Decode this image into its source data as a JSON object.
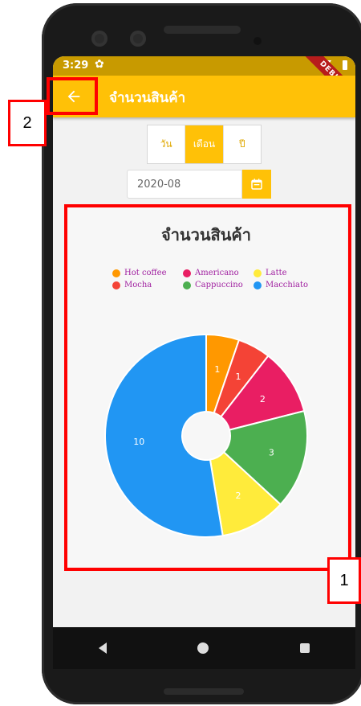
{
  "status_bar": {
    "time": "3:29",
    "debug_banner": "DEBUG"
  },
  "app_bar": {
    "title": "จำนวนสินค้า",
    "back_icon": "arrow-left-icon"
  },
  "period_tabs": [
    {
      "label": "วัน",
      "active": false
    },
    {
      "label": "เดือน",
      "active": true
    },
    {
      "label": "ปี",
      "active": false
    }
  ],
  "date_field": {
    "value": "2020-08",
    "button_icon": "calendar-icon"
  },
  "chart_data": {
    "type": "pie",
    "title": "จำนวนสินค้า",
    "donut": true,
    "legend_position": "top",
    "series": [
      {
        "name": "Hot coffee",
        "value": 1,
        "color": "#ff9800"
      },
      {
        "name": "Mocha",
        "value": 1,
        "color": "#f44336"
      },
      {
        "name": "Americano",
        "value": 2,
        "color": "#e91e63"
      },
      {
        "name": "Cappuccino",
        "value": 3,
        "color": "#4caf50"
      },
      {
        "name": "Latte",
        "value": 2,
        "color": "#ffeb3b"
      },
      {
        "name": "Macchiato",
        "value": 10,
        "color": "#2196f3"
      }
    ]
  },
  "nav_bar": {
    "back_icon": "nav-back-icon",
    "home_icon": "nav-home-icon",
    "recents_icon": "nav-recents-icon"
  },
  "annotations": {
    "label_1": "1",
    "label_2": "2"
  },
  "colors": {
    "accent": "#ffc107",
    "highlight": "#ff0000"
  }
}
